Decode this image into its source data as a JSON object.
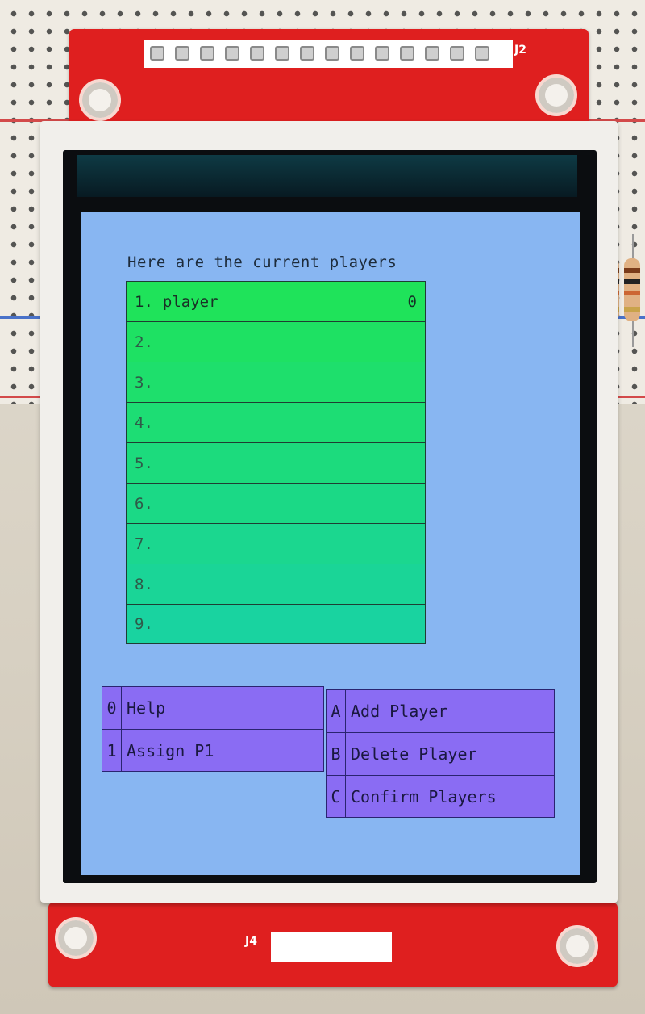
{
  "screen": {
    "title": "Here are the current players",
    "players": [
      {
        "slot": "1.",
        "name": "player",
        "score": "0"
      },
      {
        "slot": "2.",
        "name": "",
        "score": ""
      },
      {
        "slot": "3.",
        "name": "",
        "score": ""
      },
      {
        "slot": "4.",
        "name": "",
        "score": ""
      },
      {
        "slot": "5.",
        "name": "",
        "score": ""
      },
      {
        "slot": "6.",
        "name": "",
        "score": ""
      },
      {
        "slot": "7.",
        "name": "",
        "score": ""
      },
      {
        "slot": "8.",
        "name": "",
        "score": ""
      },
      {
        "slot": "9.",
        "name": "",
        "score": ""
      }
    ],
    "menu_left": [
      {
        "key": "0",
        "label": "Help"
      },
      {
        "key": "1",
        "label": "Assign P1"
      }
    ],
    "menu_right": [
      {
        "key": "A",
        "label": "Add Player"
      },
      {
        "key": "B",
        "label": "Delete Player"
      },
      {
        "key": "C",
        "label": "Confirm Players"
      }
    ]
  },
  "board": {
    "top_connector_label": "J2",
    "bottom_connector_label": "J4"
  },
  "colors": {
    "screen_bg": "#88b6f2",
    "row_gradient_top": "#1fe35a",
    "row_gradient_bottom": "#19d3a0",
    "menu_bg": "#8a6cf3",
    "pcb": "#df1f1f"
  }
}
